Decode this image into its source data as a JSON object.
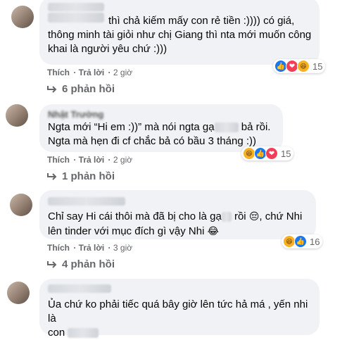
{
  "comments": [
    {
      "line1": "thì chả kiếm mấy con rẻ tiền :)))) có giá,",
      "line2": "thông minh tài giỏi như chị Giang thì nta mới muốn công",
      "line3": "khai là người yêu chứ :)))",
      "like": "Thích",
      "reply": "Trả lời",
      "time": "2 giờ",
      "reaction_count": "15",
      "replies": "6 phản hồi"
    },
    {
      "author": "Nhật Trường",
      "line1a": "Ngta mới “Hi em :))” mà nói ngta gạ",
      "line1b": "bả rồi.",
      "line2": "Ngta mà hẹn đi cf chắc bả có bầu 3 tháng :))",
      "like": "Thích",
      "reply": "Trả lời",
      "time": "2 giờ",
      "reaction_count": "15",
      "replies": "1 phản hồi"
    },
    {
      "line1a": "Chỉ say Hi cái thôi mà đã bị cho là gạ",
      "line1b": "rồi",
      "line1c": ", chứ Nhi",
      "line2": "lên tinder với mục đích gì vậy Nhi",
      "like": "Thích",
      "reply": "Trả lời",
      "time": "3 giờ",
      "reaction_count": "16",
      "replies": "4 phản hồi"
    },
    {
      "line1": "Ủa chứ ko phải tiếc quá bây giờ lên tức hả má , yến nhi là",
      "line2": "con"
    }
  ],
  "icons": {
    "like": "like-icon",
    "love": "love-icon",
    "haha": "haha-icon",
    "sad": "pensive-emoji",
    "laugh": "laughing-emoji",
    "reply_arrow": "reply-arrow-icon"
  }
}
